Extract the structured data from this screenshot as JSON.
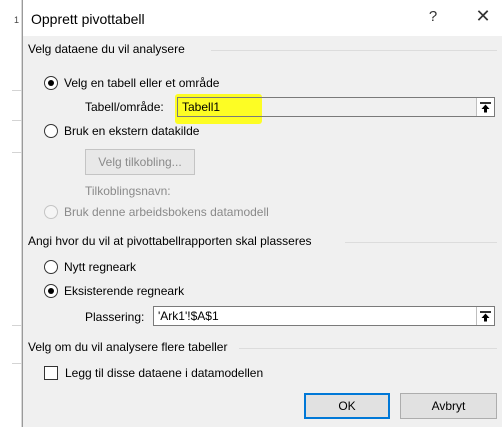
{
  "dialog": {
    "title": "Opprett pivottabell",
    "help_glyph": "?",
    "close_glyph": "✕"
  },
  "section1": {
    "title": "Velg dataene du vil analysere",
    "option_table": {
      "label": "Velg en tabell eller et område",
      "checked": true
    },
    "table_range_label": "Tabell/område:",
    "table_range_value": "Tabell1",
    "option_external": {
      "label": "Bruk en ekstern datakilde",
      "checked": false
    },
    "choose_connection_button": "Velg tilkobling...",
    "connection_name_label": "Tilkoblingsnavn:",
    "option_datamodel": {
      "label": "Bruk denne arbeidsbokens datamodell",
      "checked": false,
      "disabled": true
    }
  },
  "section2": {
    "title": "Angi hvor du vil at pivottabellrapporten skal plasseres",
    "option_new": {
      "label": "Nytt regneark",
      "checked": false
    },
    "option_existing": {
      "label": "Eksisterende regneark",
      "checked": true
    },
    "location_label": "Plassering:",
    "location_value": "'Ark1'!$A$1"
  },
  "section3": {
    "title": "Velg om du vil analysere flere tabeller",
    "add_to_datamodel": {
      "label": "Legg til disse dataene i datamodellen",
      "checked": false
    }
  },
  "buttons": {
    "ok": "OK",
    "cancel": "Avbryt"
  },
  "colors": {
    "highlight": "#ffff00",
    "default_button_border": "#0078d7",
    "dialog_background": "#f0f0f0"
  },
  "icons": {
    "help": "help-icon",
    "close": "close-icon",
    "range_picker": "range-picker-icon"
  }
}
